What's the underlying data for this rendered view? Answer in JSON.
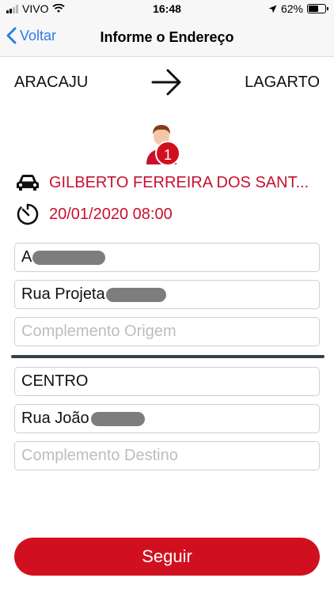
{
  "status_bar": {
    "carrier": "VIVO",
    "time": "16:48",
    "battery": "62%",
    "battery_level": 0.62
  },
  "nav": {
    "back_label": "Voltar",
    "title": "Informe o Endereço"
  },
  "route": {
    "origin": "ARACAJU",
    "destination": "LAGARTO"
  },
  "passenger": {
    "badge_count": "1",
    "driver_name": "GILBERTO FERREIRA DOS SANT...",
    "datetime": "20/01/2020 08:00"
  },
  "origin_fields": {
    "neighborhood_value": "A",
    "street_value": "Rua Projeta",
    "complement_placeholder": "Complemento Origem"
  },
  "destination_fields": {
    "neighborhood_value": "CENTRO",
    "street_value": "Rua João",
    "complement_placeholder": "Complemento Destino"
  },
  "actions": {
    "continue_label": "Seguir"
  },
  "colors": {
    "accent_red": "#d0101f",
    "link_blue": "#2f7be5"
  }
}
